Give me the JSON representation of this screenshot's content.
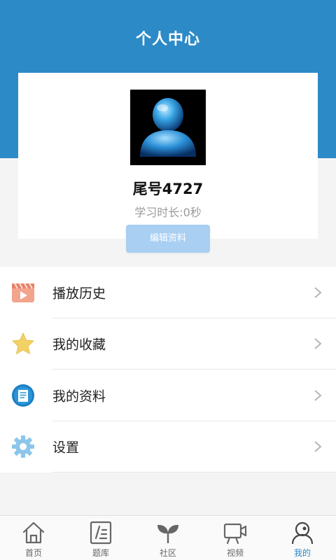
{
  "header": {
    "title": "个人中心"
  },
  "profile": {
    "username": "尾号4727",
    "study_time": "学习时长:0秒",
    "edit_label": "编辑资料"
  },
  "menu": {
    "items": [
      {
        "label": "播放历史",
        "icon": "play-history-icon"
      },
      {
        "label": "我的收藏",
        "icon": "star-icon"
      },
      {
        "label": "我的资料",
        "icon": "document-icon"
      },
      {
        "label": "设置",
        "icon": "gear-icon"
      }
    ]
  },
  "tabbar": {
    "items": [
      {
        "label": "首页",
        "icon": "home-icon"
      },
      {
        "label": "题库",
        "icon": "question-bank-icon"
      },
      {
        "label": "社区",
        "icon": "sprout-icon"
      },
      {
        "label": "视频",
        "icon": "video-camera-icon"
      },
      {
        "label": "我的",
        "icon": "user-icon",
        "active": true
      }
    ]
  },
  "colors": {
    "header_blue": "#2c8ac7",
    "edit_button": "#a9cff2",
    "active_tab": "#2c8ac7"
  }
}
